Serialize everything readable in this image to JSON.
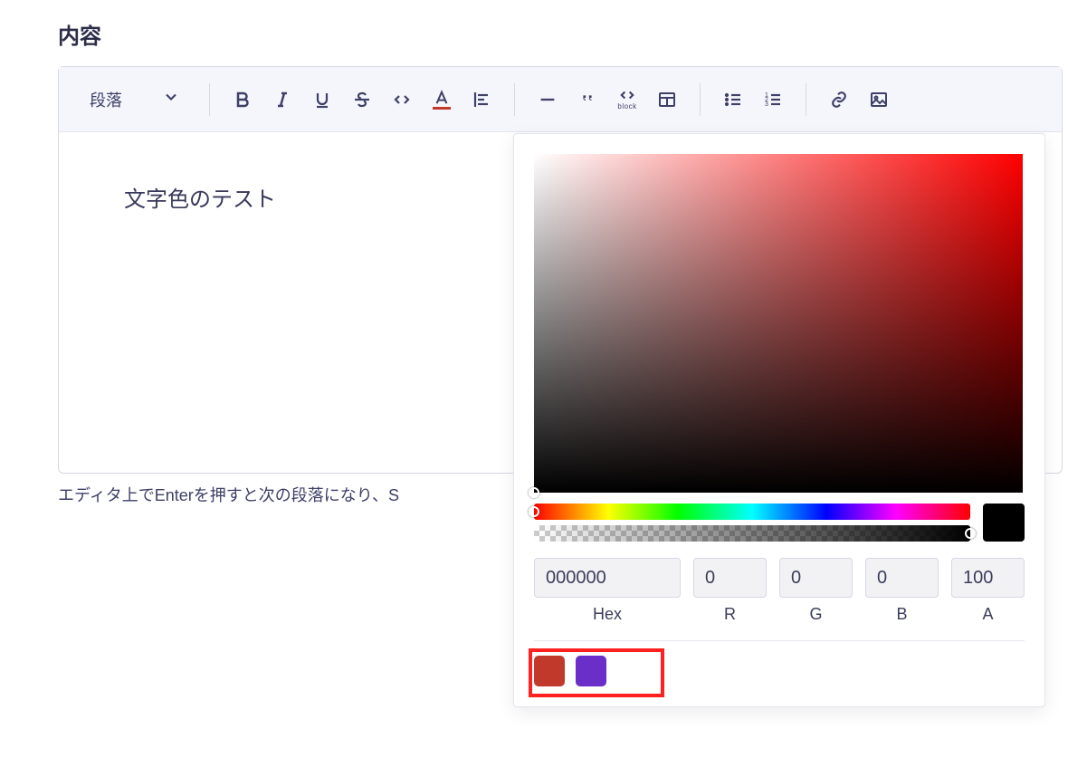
{
  "field": {
    "label": "内容"
  },
  "toolbar": {
    "format_select": "段落"
  },
  "editor": {
    "content": "文字色のテスト"
  },
  "helper": {
    "text": "エディタ上でEnterを押すと次の段落になり、S"
  },
  "picker": {
    "hex": "000000",
    "r": "0",
    "g": "0",
    "b": "0",
    "a": "100",
    "labels": {
      "hex": "Hex",
      "r": "R",
      "g": "G",
      "b": "B",
      "a": "A"
    },
    "presets": [
      {
        "name": "red",
        "color": "#c0392b"
      },
      {
        "name": "purple",
        "color": "#6a2ec9"
      }
    ]
  }
}
